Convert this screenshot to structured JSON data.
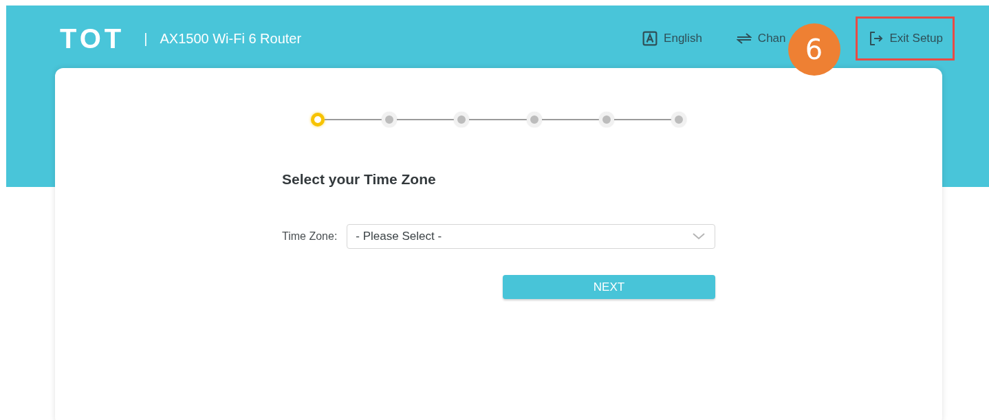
{
  "header": {
    "logo": "TOT",
    "separator": "|",
    "product": "AX1500 Wi-Fi 6 Router",
    "nav": [
      {
        "kind": "language",
        "label": "English",
        "highlighted": false
      },
      {
        "kind": "change",
        "label": "Chan",
        "highlighted": false
      },
      {
        "kind": "exit",
        "label": "Exit Setup",
        "highlighted": true
      }
    ]
  },
  "callout": {
    "number": "6"
  },
  "steps": [
    {
      "selected": true
    },
    {
      "selected": false
    },
    {
      "selected": false
    },
    {
      "selected": false
    },
    {
      "selected": false
    },
    {
      "selected": false
    }
  ],
  "form": {
    "title": "Select your Time Zone",
    "label": "Time Zone:",
    "select_value": "- Please Select -",
    "button": "NEXT"
  }
}
